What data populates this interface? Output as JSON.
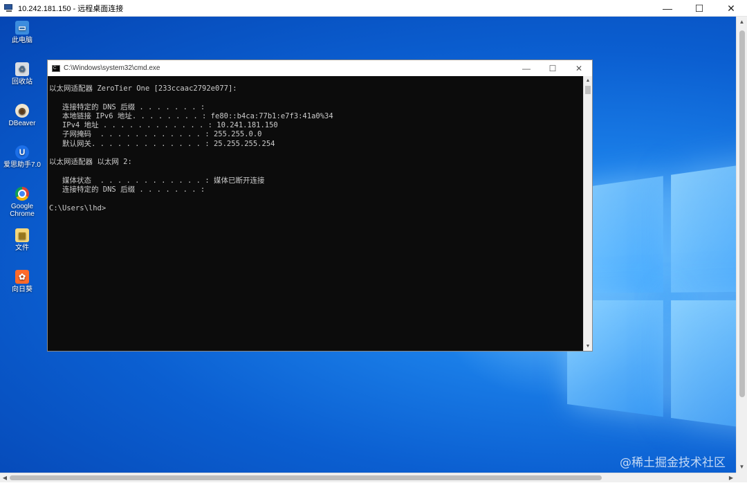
{
  "rdp": {
    "title": "10.242.181.150 - 远程桌面连接",
    "minimize": "—",
    "maximize": "☐",
    "close": "✕"
  },
  "desktop_icons": [
    {
      "label": "此电脑",
      "icon": "computer-icon",
      "color": "#3c8dde"
    },
    {
      "label": "回收站",
      "icon": "recycle-bin-icon",
      "color": "#d8dde3"
    },
    {
      "label": "DBeaver",
      "icon": "dbeaver-icon",
      "color": "#f0e6d0"
    },
    {
      "label": "爱思助手7.0",
      "icon": "aisi-icon",
      "color": "#1c6fe8"
    },
    {
      "label": "Google Chrome",
      "icon": "chrome-icon",
      "color": "#ffffff"
    },
    {
      "label": "文件",
      "icon": "folder-icon",
      "color": "#f5d77a"
    },
    {
      "label": "向日葵",
      "icon": "sunflower-icon",
      "color": "#ff6a2a"
    }
  ],
  "cmd": {
    "title": "C:\\Windows\\system32\\cmd.exe",
    "minimize": "—",
    "maximize": "☐",
    "close": "✕",
    "lines": [
      "以太网适配器 ZeroTier One [233ccaac2792e077]:",
      "",
      "   连接特定的 DNS 后缀 . . . . . . . :",
      "   本地链接 IPv6 地址. . . . . . . . : fe80::b4ca:77b1:e7f3:41a0%34",
      "   IPv4 地址 . . . . . . . . . . . . : 10.241.181.150",
      "   子网掩码  . . . . . . . . . . . . : 255.255.0.0",
      "   默认网关. . . . . . . . . . . . . : 25.255.255.254",
      "",
      "以太网适配器 以太网 2:",
      "",
      "   媒体状态  . . . . . . . . . . . . : 媒体已断开连接",
      "   连接特定的 DNS 后缀 . . . . . . . :",
      "",
      "C:\\Users\\lhd>"
    ]
  },
  "watermark": "@稀土掘金技术社区"
}
